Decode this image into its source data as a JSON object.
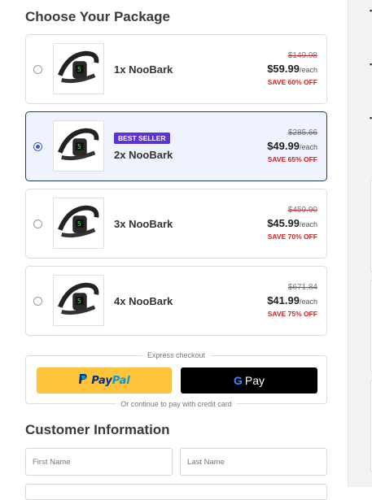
{
  "headings": {
    "packages": "Choose Your Package",
    "customer": "Customer Information"
  },
  "packages": [
    {
      "name": "1x NooBark",
      "original_price": "$149.98",
      "price": "$59.99",
      "unit": "/each",
      "save": "SAVE 60% OFF",
      "selected": false,
      "badge": ""
    },
    {
      "name": "2x NooBark",
      "original_price": "$285.66",
      "price": "$49.99",
      "unit": "/each",
      "save": "SAVE 65% OFF",
      "selected": true,
      "badge": "BEST SELLER"
    },
    {
      "name": "3x NooBark",
      "original_price": "$459.90",
      "price": "$45.99",
      "unit": "/each",
      "save": "SAVE 70% OFF",
      "selected": false,
      "badge": ""
    },
    {
      "name": "4x NooBark",
      "original_price": "$671.84",
      "price": "$41.99",
      "unit": "/each",
      "save": "SAVE 75% OFF",
      "selected": false,
      "badge": ""
    }
  ],
  "express": {
    "label": "Express checkout",
    "paypal_part1": "Pay",
    "paypal_part2": "Pal",
    "gpay_g": "G",
    "gpay_label": "Pay",
    "continue_label": "Or continue to pay with credit card"
  },
  "form": {
    "first_name_placeholder": "First Name",
    "last_name_placeholder": "Last Name"
  },
  "colors": {
    "selected_border": "#1f3a7a",
    "selected_bg": "#eef3fd",
    "badge": "#5b33d6",
    "save_text": "#d21f1f",
    "paypal_button": "#ffc439",
    "gpay_button": "#000000"
  },
  "icons": {
    "product": "dog-collar-image",
    "paypal": "paypal-logo-icon",
    "google": "google-g-icon"
  }
}
